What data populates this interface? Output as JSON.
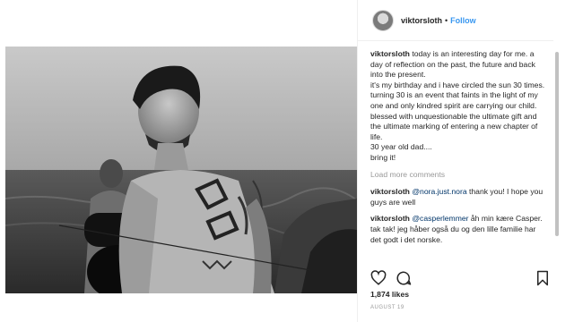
{
  "header": {
    "username": "viktorsloth",
    "separator": "•",
    "follow_label": "Follow",
    "avatar_icon": "profile-avatar"
  },
  "caption": {
    "username": "viktorsloth",
    "lines": [
      "today is an interesting day for me. a day of reflection on the past, the future and back into the present.",
      "it's my birthday and i have circled the sun 30 times.",
      "turning 30 is an event that faints in the light of my one and only kindred spirit are carrying our child. blessed with unquestionable the ultimate gift and the ultimate marking of entering a new chapter of life.",
      "30 year old dad....",
      "bring it!"
    ]
  },
  "load_more_label": "Load more comments",
  "comments": [
    {
      "username": "viktorsloth",
      "mention": "@nora.just.nora",
      "text": " thank you! I hope you guys are well"
    },
    {
      "username": "viktorsloth",
      "mention": "@casperlemmer",
      "text": " åh min kære Casper. tak tak! jeg håber også du og den lille familie har det godt i det norske."
    }
  ],
  "actions": {
    "like_icon": "heart-icon",
    "comment_icon": "comment-icon",
    "save_icon": "bookmark-icon"
  },
  "likes_text": "1,874 likes",
  "date_text": "AUGUST 19"
}
